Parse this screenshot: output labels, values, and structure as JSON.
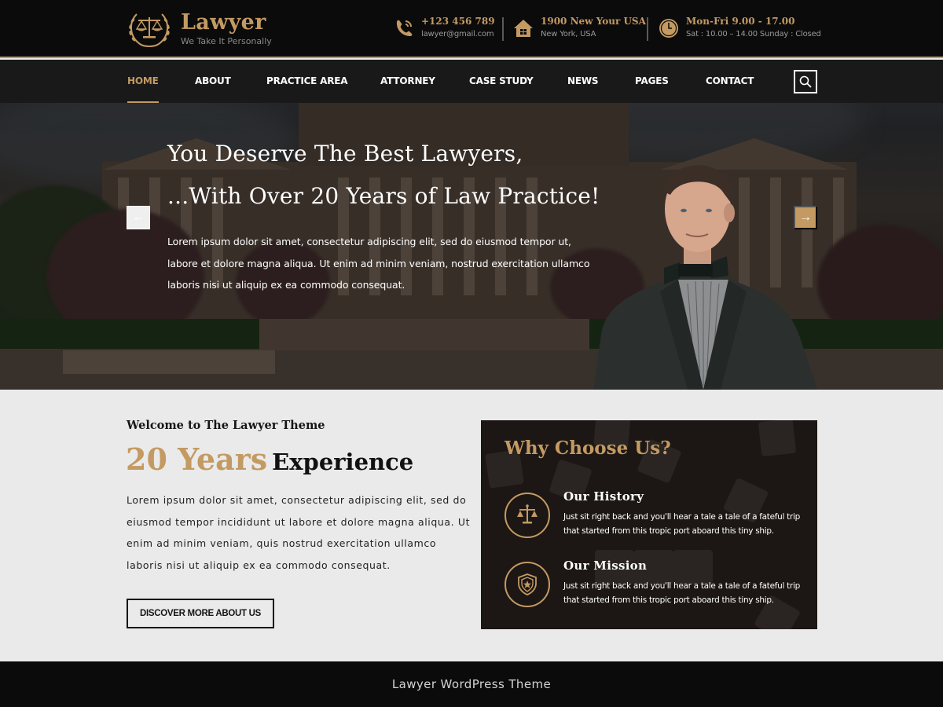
{
  "brand": {
    "name": "Lawyer",
    "tagline": "We Take It Personally",
    "logo_icon": "scales-laurel-icon",
    "accent_color": "#c49a63",
    "dark_color": "#0b0b0b"
  },
  "header": {
    "contacts": [
      {
        "icon": "phone-icon",
        "main": "+123 456 789",
        "sub": "lawyer@gmail.com"
      },
      {
        "icon": "home-icon",
        "main": "1900 New Your USA",
        "sub": "New York, USA"
      },
      {
        "icon": "clock-icon",
        "main": "Mon-Fri 9.00 - 17.00",
        "sub": "Sat : 10.00 – 14.00 Sunday : Closed"
      }
    ]
  },
  "nav": {
    "items": [
      {
        "label": "HOME",
        "active": true
      },
      {
        "label": "ABOUT",
        "active": false
      },
      {
        "label": "PRACTICE AREA",
        "active": false
      },
      {
        "label": "ATTORNEY",
        "active": false
      },
      {
        "label": "CASE STUDY",
        "active": false
      },
      {
        "label": "NEWS",
        "active": false
      },
      {
        "label": "PAGES",
        "active": false
      },
      {
        "label": "CONTACT",
        "active": false
      }
    ],
    "search_icon": "search-icon"
  },
  "hero": {
    "title_line1": "You Deserve The Best Lawyers,",
    "title_line2": "...With Over 20 Years of Law Practice!",
    "text": "Lorem ipsum dolor sit amet, consectetur adipiscing elit, sed do eiusmod tempor ut, labore et dolore magna aliqua. Ut enim ad minim veniam, nostrud exercitation ullamco laboris nisi ut aliquip ex ea commodo consequat.",
    "prev_arrow": "←",
    "next_arrow": "→"
  },
  "about": {
    "welcome": "Welcome to The Lawyer Theme",
    "years": "20 Years",
    "experience": "Experience",
    "text": "Lorem ipsum dolor sit amet, consectetur adipiscing elit, sed do eiusmod tempor incididunt ut labore et dolore magna aliqua. Ut enim ad minim veniam, quis nostrud exercitation ullamco laboris nisi ut aliquip ex ea commodo consequat.",
    "button_label": "DISCOVER MORE ABOUT US"
  },
  "why": {
    "title": "Why Choose Us?",
    "items": [
      {
        "icon": "scales-icon",
        "title": "Our History",
        "text": "Just sit right back and you'll hear a tale a tale of a fateful trip that started from this tropic port aboard this tiny ship."
      },
      {
        "icon": "shield-star-icon",
        "title": "Our Mission",
        "text": "Just sit right back and you'll hear a tale a tale of a fateful trip that started from this tropic port aboard this tiny ship."
      }
    ]
  },
  "footer": {
    "text": "Lawyer WordPress Theme"
  }
}
